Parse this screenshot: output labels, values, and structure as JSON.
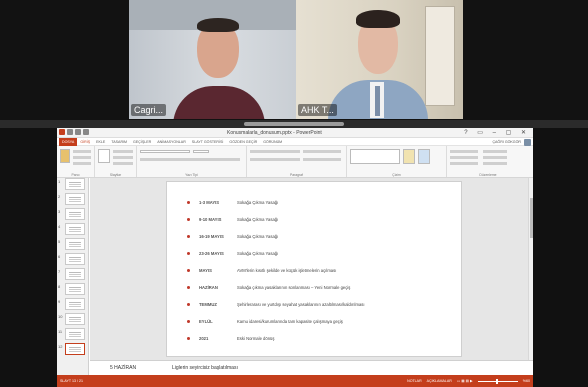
{
  "video": {
    "participants": [
      {
        "name": "Cagri..."
      },
      {
        "name": "AHK T..."
      }
    ]
  },
  "powerpoint": {
    "window_title": "Konusmalarla_donusum.pptx - PowerPoint",
    "ribbon_tabs": [
      "DOSYA",
      "GİRİŞ",
      "EKLE",
      "TASARIM",
      "GEÇİŞLER",
      "ANİMASYONLAR",
      "SLAYT GÖSTERİSİ",
      "GÖZDEN GEÇİR",
      "GÖRÜNÜM"
    ],
    "user_name": "ÇAĞRI GÖKGÖR",
    "ribbon_group_labels": [
      "Pano",
      "Slaytlar",
      "Yazı Tipi",
      "Paragraf",
      "Çizim",
      "Düzenleme"
    ],
    "thumbnail_numbers": [
      "1",
      "2",
      "3",
      "4",
      "5",
      "6",
      "7",
      "8",
      "9",
      "10",
      "11",
      "12"
    ],
    "slide": {
      "timeline": [
        {
          "date": "1-3 MAYIS",
          "desc": "Sokağa Çıkma Yasağı"
        },
        {
          "date": "9-10 MAYIS",
          "desc": "Sokağa Çıkma Yasağı"
        },
        {
          "date": "16-19 MAYIS",
          "desc": "Sokağa Çıkma Yasağı"
        },
        {
          "date": "23-26 MAYIS",
          "desc": "Sokağa Çıkma Yasağı"
        },
        {
          "date": "MAYIS",
          "desc": "AVM'lerin kısıtlı şekilde ve küçük işletmelerin açılması"
        },
        {
          "date": "HAZİRAN",
          "desc": "Sokağa çıkma yasaklarının sonlanması – Yeni Normale geçiş"
        },
        {
          "date": "TEMMUZ",
          "desc": "Şehirlerarası ve yurtdışı seyahat yasaklarının azaltılması/kaldırılması"
        },
        {
          "date": "EYLÜL",
          "desc": "Kamu idaresi/kurumlarında tam kapasite çalışmaya geçiş"
        },
        {
          "date": "2021",
          "desc": "Eski Normale dönüş"
        }
      ]
    },
    "notes": {
      "date": "5 HAZİRAN",
      "desc": "Lig­lerin seyircisiz başlatılması"
    },
    "statusbar": {
      "slide_info": "SLAYT 13 / 21",
      "notes_label": "NOTLAR",
      "comments_label": "AÇIKLAMALAR",
      "zoom": "%60"
    }
  }
}
